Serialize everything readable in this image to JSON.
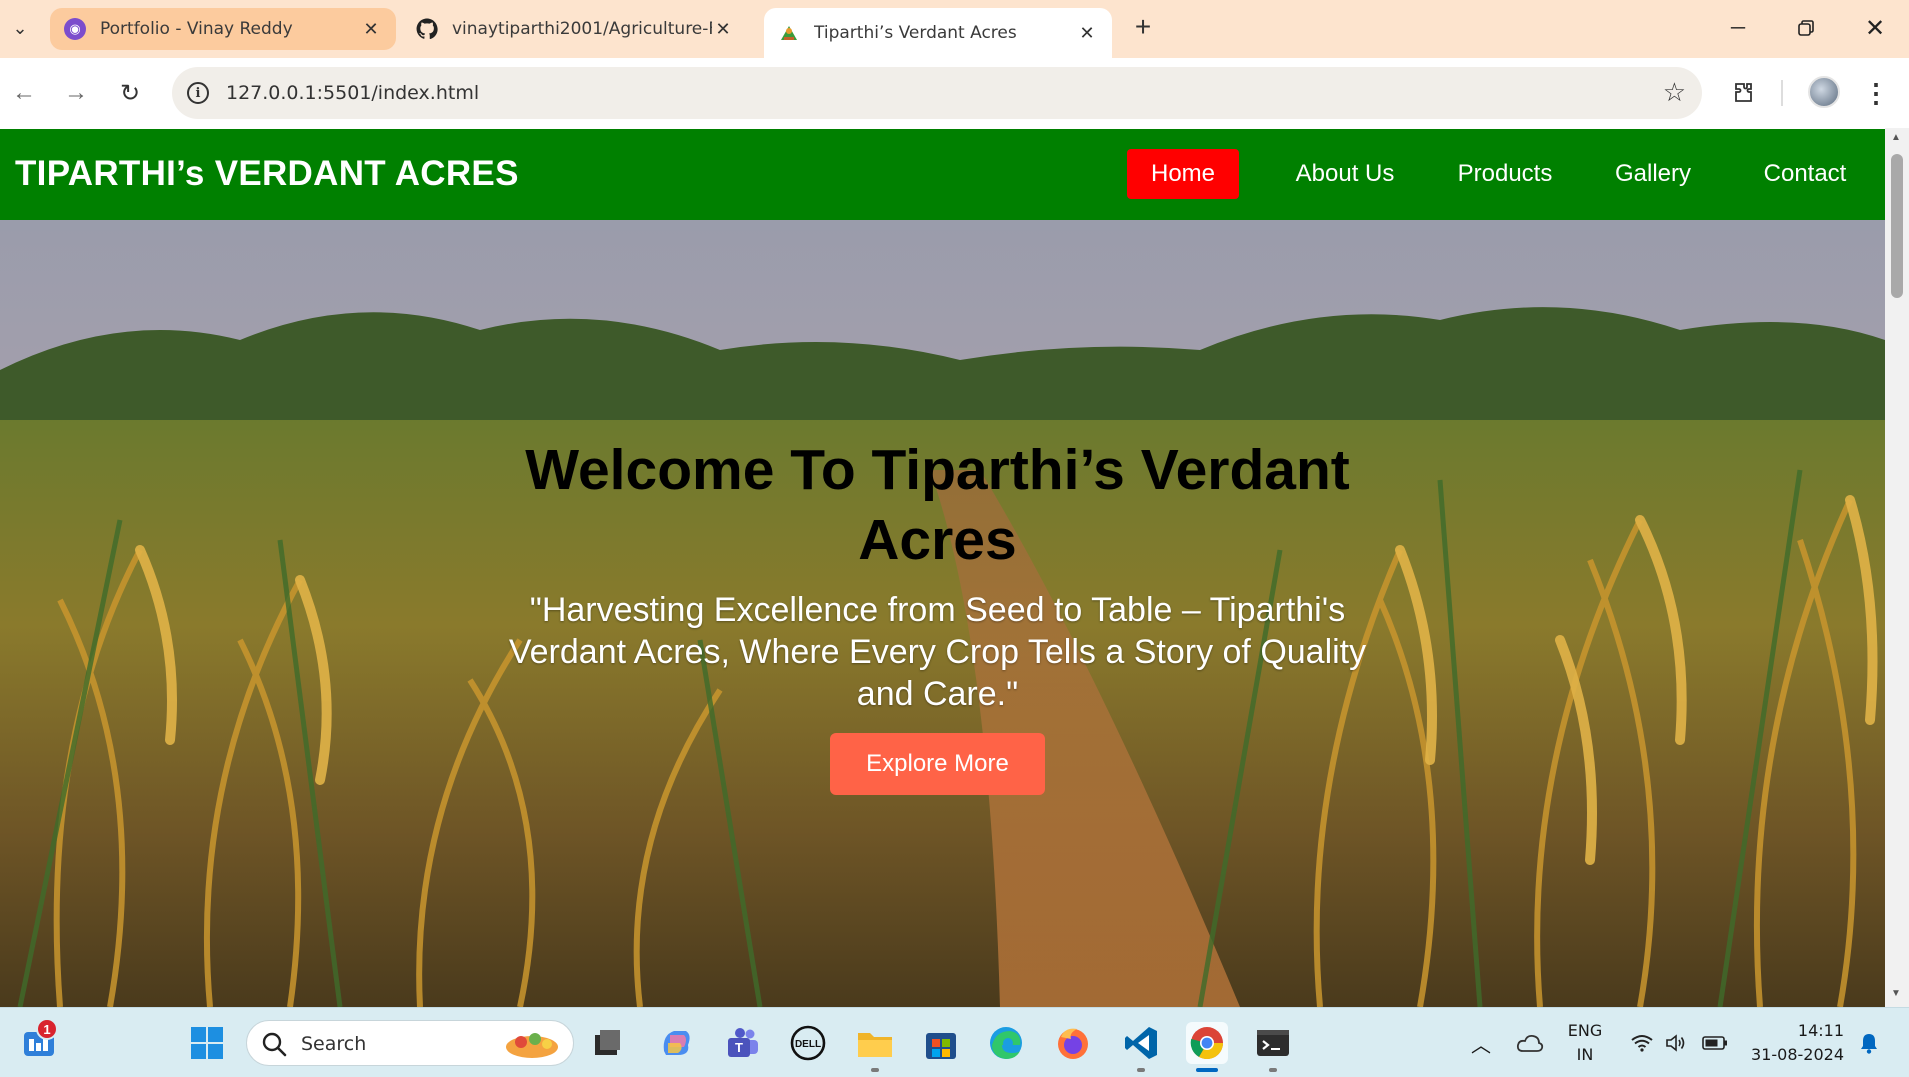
{
  "browser": {
    "tabs": [
      {
        "title": "Portfolio - Vinay Reddy",
        "active": false
      },
      {
        "title": "vinaytiparthi2001/Agriculture-F",
        "active": false
      },
      {
        "title": "Tiparthi’s Verdant Acres",
        "active": true
      }
    ],
    "new_tab_label": "+",
    "address": "127.0.0.1:5501/index.html"
  },
  "site": {
    "logo": "TIPARTHI’s VERDANT ACRES",
    "nav": [
      {
        "label": "Home",
        "active": true
      },
      {
        "label": "About Us",
        "active": false
      },
      {
        "label": "Products",
        "active": false
      },
      {
        "label": "Gallery",
        "active": false
      },
      {
        "label": "Contact",
        "active": false
      }
    ],
    "hero": {
      "title": "Welcome To Tiparthi’s Verdant Acres",
      "tagline": "\"Harvesting Excellence from Seed to Table – Tiparthi's Verdant Acres, Where Every Crop Tells a Story of Quality and Care.\"",
      "button": "Explore More"
    },
    "colors": {
      "header": "#008000",
      "active_nav": "#ff0000",
      "cta": "#ff6347"
    }
  },
  "taskbar": {
    "notification_count": "1",
    "search_placeholder": "Search",
    "language": "ENG",
    "region": "IN",
    "time": "14:11",
    "date": "31-08-2024",
    "apps": [
      "widgets-icon",
      "start-icon",
      "task-view-icon",
      "copilot-icon",
      "teams-icon",
      "dell-icon",
      "file-explorer-icon",
      "store-icon",
      "edge-icon",
      "firefox-icon",
      "vscode-icon",
      "chrome-icon",
      "terminal-icon"
    ]
  }
}
